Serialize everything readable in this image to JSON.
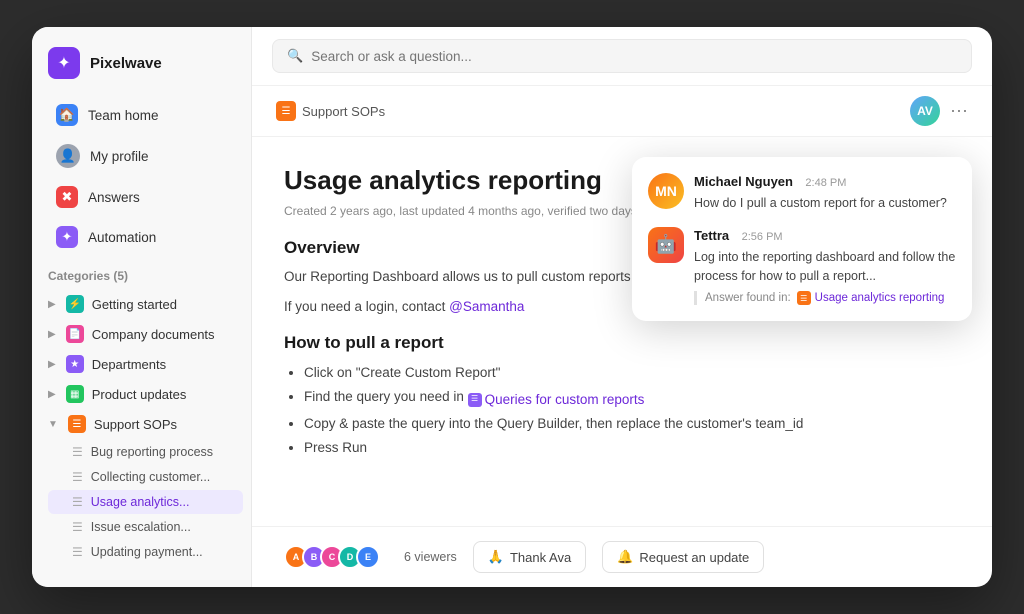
{
  "app": {
    "name": "Pixelwave"
  },
  "sidebar": {
    "nav": [
      {
        "id": "team-home",
        "label": "Team home",
        "icon": "🏠",
        "iconClass": "blue"
      },
      {
        "id": "my-profile",
        "label": "My profile",
        "icon": "👤",
        "iconClass": "gray"
      },
      {
        "id": "answers",
        "label": "Answers",
        "icon": "✖",
        "iconClass": "red"
      },
      {
        "id": "automation",
        "label": "Automation",
        "icon": "✦",
        "iconClass": "purple"
      }
    ],
    "categories_header": "Categories (5)",
    "categories": [
      {
        "id": "getting-started",
        "label": "Getting started",
        "iconClass": "teal",
        "expanded": false
      },
      {
        "id": "company-documents",
        "label": "Company documents",
        "iconClass": "pink",
        "expanded": false
      },
      {
        "id": "departments",
        "label": "Departments",
        "iconClass": "purple",
        "expanded": false
      },
      {
        "id": "product-updates",
        "label": "Product updates",
        "iconClass": "green",
        "expanded": false
      },
      {
        "id": "support-sops",
        "label": "Support SOPs",
        "iconClass": "orange",
        "expanded": true
      }
    ],
    "sub_items": [
      {
        "id": "bug-reporting",
        "label": "Bug reporting process",
        "active": false
      },
      {
        "id": "collecting-customer",
        "label": "Collecting customer...",
        "active": false
      },
      {
        "id": "usage-analytics",
        "label": "Usage analytics...",
        "active": true
      },
      {
        "id": "issue-escalation",
        "label": "Issue escalation...",
        "active": false
      },
      {
        "id": "updating-payment",
        "label": "Updating payment...",
        "active": false
      }
    ]
  },
  "topbar": {
    "search_placeholder": "Search or ask a question..."
  },
  "breadcrumb": {
    "title": "Support SOPs"
  },
  "article": {
    "title": "Usage analytics reporting",
    "meta": "Created 2 years ago, last updated 4 months ago, verified two days ago",
    "overview_heading": "Overview",
    "overview_text": "Our Reporting Dashboard allows us to pull custom reports for our",
    "overview_text2": "If you need a login, contact",
    "contact_name": "@Samantha",
    "how_to_heading": "How to pull a report",
    "steps": [
      "Click on \"Create Custom Report\"",
      "Find the query you need in",
      "Copy & paste the query into the Query Builder, then replace the customer's team_id",
      "Press Run"
    ],
    "queries_link": "Queries for custom reports"
  },
  "footer": {
    "viewers_count": "6 viewers",
    "thank_label": "Thank Ava",
    "request_label": "Request an update"
  },
  "chat": {
    "message1": {
      "name": "Michael Nguyen",
      "time": "2:48 PM",
      "text": "How do I pull a custom report for a customer?"
    },
    "message2": {
      "name": "Tettra",
      "time": "2:56 PM",
      "text": "Log into the reporting dashboard and follow the process for how to pull a report...",
      "source_label": "Answer found in:",
      "source_link": "Usage analytics reporting"
    }
  },
  "colors": {
    "accent": "#6d28d9",
    "orange": "#f97316",
    "teal": "#14b8a6",
    "pink": "#ec4899",
    "green": "#22c55e",
    "active_bg": "#ede9fe"
  }
}
